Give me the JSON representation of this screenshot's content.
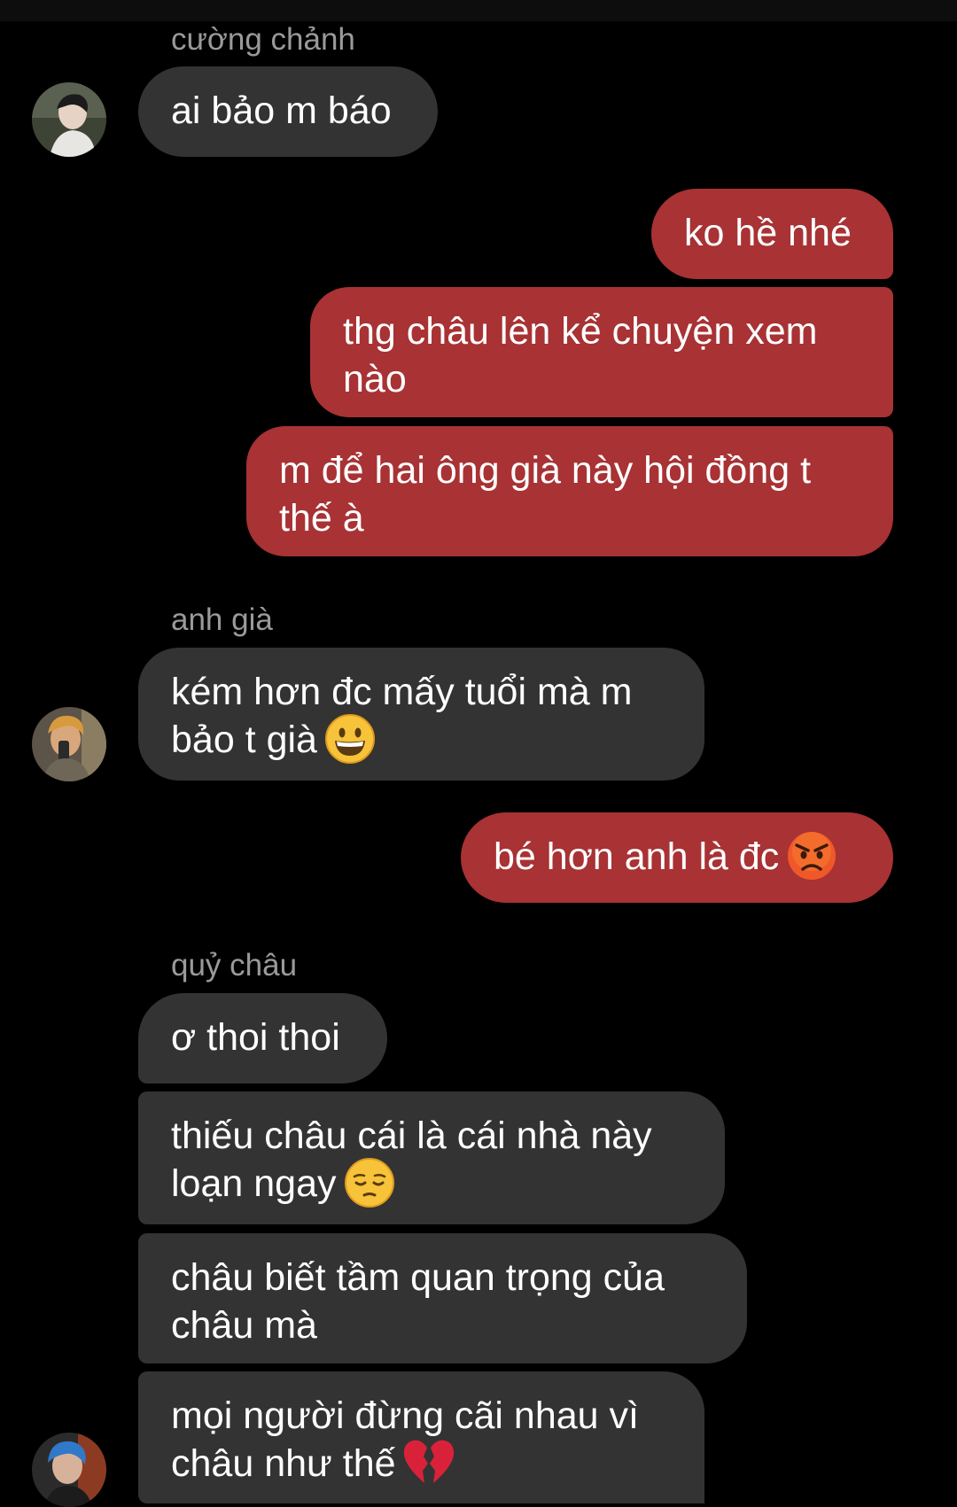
{
  "colors": {
    "background": "#000000",
    "incoming_bubble": "#333333",
    "outgoing_bubble": "#a83234",
    "sender_name": "#9a9a9a",
    "text": "#ffffff"
  },
  "messages": [
    {
      "direction": "incoming",
      "sender": "cường chảnh",
      "lines": [
        "ai bảo m báo"
      ]
    },
    {
      "direction": "outgoing",
      "lines": [
        "ko hề nhé"
      ]
    },
    {
      "direction": "outgoing",
      "lines": [
        "thg châu lên kể chuyện xem",
        "nào"
      ]
    },
    {
      "direction": "outgoing",
      "lines": [
        "m để hai ông già này hội đồng t",
        "thế à"
      ]
    },
    {
      "direction": "incoming",
      "sender": "anh già",
      "lines": [
        "kém hơn đc mấy tuổi mà m",
        "bảo t già"
      ],
      "emoji": "grinning-face-emoji"
    },
    {
      "direction": "outgoing",
      "lines": [
        "bé hơn anh là đc"
      ],
      "emoji": "angry-face-emoji"
    },
    {
      "direction": "incoming",
      "sender": "quỷ châu",
      "lines": [
        "ơ thoi thoi"
      ]
    },
    {
      "direction": "incoming",
      "lines": [
        "thiếu châu cái là cái nhà này",
        "loạn ngay"
      ],
      "emoji": "pensive-face-emoji"
    },
    {
      "direction": "incoming",
      "lines": [
        "châu biết tầm quan trọng của",
        "châu mà"
      ]
    },
    {
      "direction": "incoming",
      "lines": [
        "mọi người đừng cãi nhau vì",
        "châu như thế"
      ],
      "emoji": "broken-heart-emoji"
    }
  ]
}
